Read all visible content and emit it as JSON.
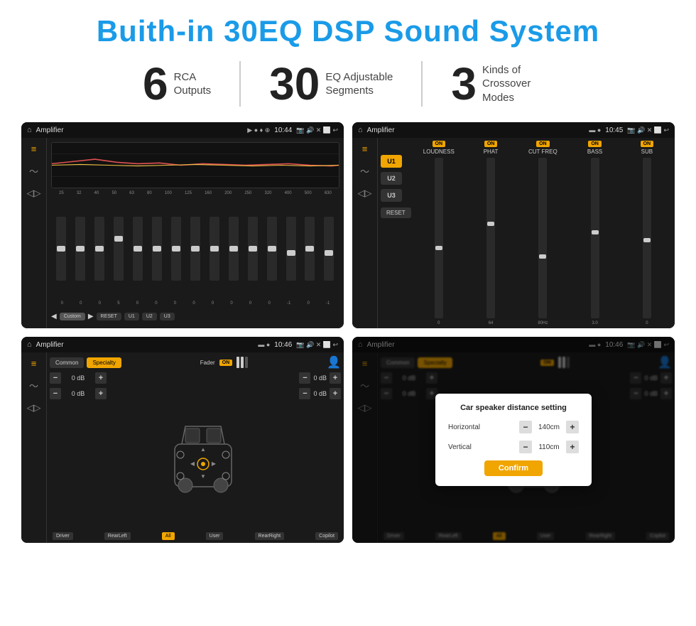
{
  "title": "Buith-in 30EQ DSP Sound System",
  "stats": [
    {
      "number": "6",
      "text": "RCA\nOutputs"
    },
    {
      "number": "30",
      "text": "EQ Adjustable\nSegments"
    },
    {
      "number": "3",
      "text": "Kinds of\nCrossover Modes"
    }
  ],
  "screens": {
    "top_left": {
      "app": "Amplifier",
      "time": "10:44",
      "eq_freqs": [
        "25",
        "32",
        "40",
        "50",
        "63",
        "80",
        "100",
        "125",
        "160",
        "200",
        "250",
        "320",
        "400",
        "500",
        "630"
      ],
      "eq_values": [
        "0",
        "0",
        "0",
        "5",
        "0",
        "0",
        "0",
        "0",
        "0",
        "0",
        "0",
        "0",
        "-1",
        "0",
        "-1"
      ],
      "preset": "Custom",
      "buttons": [
        "RESET",
        "U1",
        "U2",
        "U3"
      ]
    },
    "top_right": {
      "app": "Amplifier",
      "time": "10:45",
      "presets": [
        "U1",
        "U2",
        "U3"
      ],
      "channels": [
        "LOUDNESS",
        "PHAT",
        "CUT FREQ",
        "BASS",
        "SUB"
      ],
      "reset": "RESET"
    },
    "bottom_left": {
      "app": "Amplifier",
      "time": "10:46",
      "tabs": [
        "Common",
        "Specialty"
      ],
      "fader": "Fader",
      "db_rows": [
        {
          "left": "0 dB",
          "right": "0 dB"
        },
        {
          "left": "0 dB",
          "right": "0 dB"
        }
      ],
      "labels": [
        "Driver",
        "RearLeft",
        "All",
        "User",
        "RearRight",
        "Copilot"
      ]
    },
    "bottom_right": {
      "app": "Amplifier",
      "time": "10:46",
      "tabs": [
        "Common",
        "Specialty"
      ],
      "dialog": {
        "title": "Car speaker distance setting",
        "horizontal_label": "Horizontal",
        "horizontal_value": "140cm",
        "vertical_label": "Vertical",
        "vertical_value": "110cm",
        "confirm_label": "Confirm"
      },
      "labels": [
        "Driver",
        "RearLeft",
        "All",
        "User",
        "RearRight",
        "Copilot"
      ],
      "db_rows": [
        {
          "right": "0 dB"
        },
        {
          "right": "0 dB"
        }
      ]
    }
  }
}
